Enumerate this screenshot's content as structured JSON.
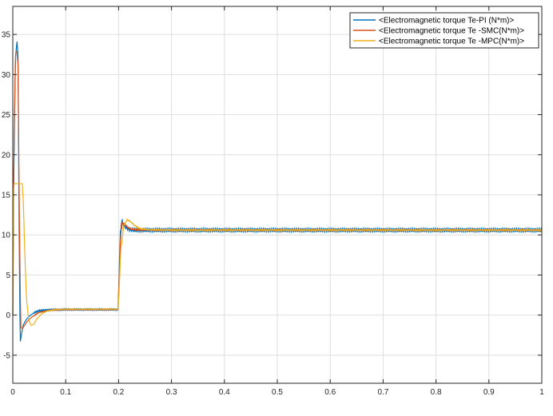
{
  "colors": {
    "background": "#ffffff",
    "axes": "#262626",
    "grid": "#dfdfdf",
    "series": [
      "#0072bd",
      "#d95319",
      "#edb120"
    ]
  },
  "chart_data": {
    "type": "line",
    "title": "",
    "xlabel": "",
    "ylabel": "",
    "xlim": [
      0,
      1
    ],
    "ylim": [
      -8.5,
      38.5
    ],
    "xticks": [
      0,
      0.1,
      0.2,
      0.3,
      0.4,
      0.5,
      0.6,
      0.7,
      0.8,
      0.9,
      1
    ],
    "xtick_labels": [
      "0",
      "0.1",
      "0.2",
      "0.3",
      "0.4",
      "0.5",
      "0.6",
      "0.7",
      "0.8",
      "0.9",
      "1"
    ],
    "yticks": [
      -5,
      0,
      5,
      10,
      15,
      20,
      25,
      30,
      35
    ],
    "ytick_labels": [
      "-5",
      "0",
      "5",
      "10",
      "15",
      "20",
      "25",
      "30",
      "35"
    ],
    "grid": true,
    "legend_position": "top-right",
    "series": [
      {
        "name": "<Electromagnetic torque Te-PI (N*m)>",
        "color": "#0072bd",
        "x": [
          0,
          0.002,
          0.005,
          0.008,
          0.01,
          0.012,
          0.014,
          0.017,
          0.02,
          0.025,
          0.03,
          0.04,
          0.05,
          0.07,
          0.1,
          0.15,
          0.19,
          0.199,
          0.201,
          0.203,
          0.206,
          0.21,
          0.215,
          0.22,
          0.23,
          0.25,
          0.3,
          0.4,
          0.5,
          0.6,
          0.7,
          0.8,
          0.9,
          1.0
        ],
        "y": [
          0,
          18,
          32,
          34.2,
          32,
          10,
          -3.4,
          -2.2,
          -1.2,
          -0.6,
          -0.2,
          0.3,
          0.55,
          0.65,
          0.7,
          0.7,
          0.7,
          0.7,
          5,
          10,
          11.8,
          11.2,
          10.9,
          10.7,
          10.6,
          10.6,
          10.6,
          10.6,
          10.6,
          10.6,
          10.6,
          10.6,
          10.6,
          10.6
        ],
        "ripple": 0.28
      },
      {
        "name": "<Electromagnetic torque Te -SMC(N*m)>",
        "color": "#d95319",
        "x": [
          0,
          0.002,
          0.005,
          0.008,
          0.01,
          0.012,
          0.015,
          0.018,
          0.022,
          0.027,
          0.035,
          0.05,
          0.07,
          0.1,
          0.15,
          0.19,
          0.199,
          0.201,
          0.204,
          0.207,
          0.212,
          0.218,
          0.225,
          0.24,
          0.3,
          0.4,
          0.5,
          0.6,
          0.7,
          0.8,
          0.9,
          1.0
        ],
        "y": [
          0,
          20,
          32.5,
          33.0,
          31,
          15,
          -1.5,
          -1.7,
          -1.3,
          -0.8,
          -0.3,
          0.35,
          0.6,
          0.7,
          0.7,
          0.7,
          0.7,
          4.5,
          10,
          11.5,
          11.3,
          10.9,
          10.7,
          10.65,
          10.6,
          10.6,
          10.6,
          10.6,
          10.6,
          10.6,
          10.6,
          10.6
        ],
        "ripple": 0.12
      },
      {
        "name": "<Electromagnetic torque Te -MPC(N*m)>",
        "color": "#edb120",
        "x": [
          0,
          0.0008,
          0.002,
          0.018,
          0.02,
          0.023,
          0.026,
          0.03,
          0.035,
          0.04,
          0.045,
          0.055,
          0.065,
          0.08,
          0.1,
          0.15,
          0.19,
          0.199,
          0.201,
          0.204,
          0.21,
          0.216,
          0.222,
          0.23,
          0.24,
          0.25,
          0.26,
          0.3,
          0.4,
          0.5,
          0.6,
          0.7,
          0.8,
          0.9,
          1.0
        ],
        "y": [
          0,
          12,
          16.4,
          16.4,
          14,
          7,
          2,
          -0.6,
          -1.3,
          -1.1,
          -0.5,
          0.2,
          0.5,
          0.7,
          0.75,
          0.75,
          0.75,
          0.75,
          3,
          8,
          11.2,
          11.9,
          11.7,
          11.2,
          10.8,
          10.7,
          10.65,
          10.6,
          10.6,
          10.6,
          10.6,
          10.6,
          10.6,
          10.6,
          10.6
        ],
        "ripple": 0.08
      }
    ]
  }
}
